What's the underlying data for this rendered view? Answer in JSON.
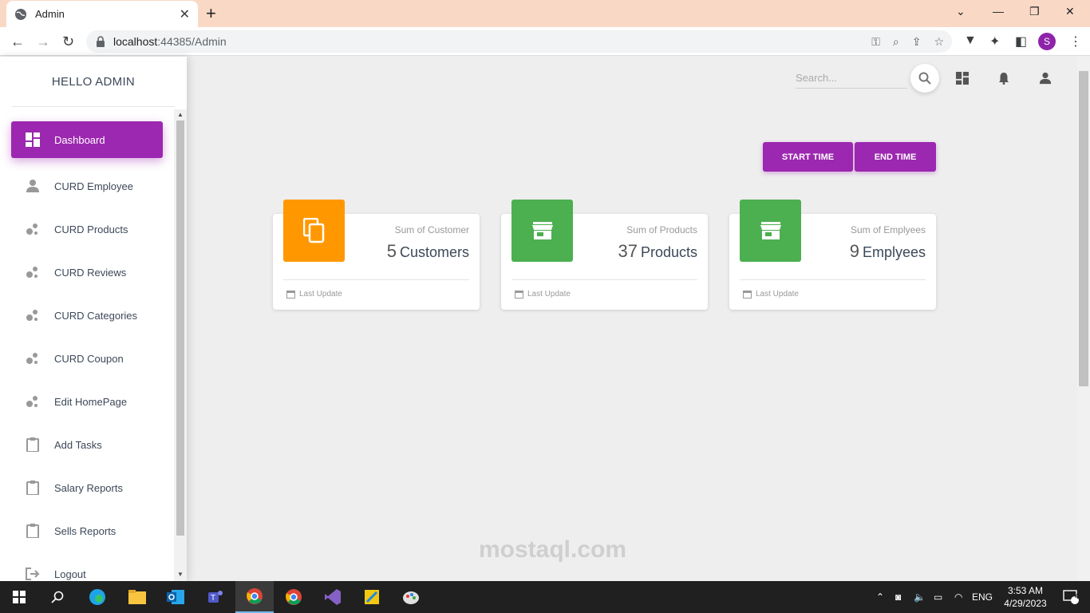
{
  "browser": {
    "tab_title": "Admin",
    "url_host": "localhost",
    "url_port_path": ":44385/Admin",
    "profile_initial": "S"
  },
  "sidebar": {
    "brand": "HELLO ADMIN",
    "items": [
      {
        "label": "Dashboard",
        "icon": "dashboard-icon",
        "active": true
      },
      {
        "label": "CURD Employee",
        "icon": "person-icon"
      },
      {
        "label": "CURD Products",
        "icon": "bubble-chart-icon"
      },
      {
        "label": "CURD Reviews",
        "icon": "bubble-chart-icon"
      },
      {
        "label": "CURD Categories",
        "icon": "bubble-chart-icon"
      },
      {
        "label": "CURD Coupon",
        "icon": "bubble-chart-icon"
      },
      {
        "label": "Edit HomePage",
        "icon": "bubble-chart-icon"
      },
      {
        "label": "Add Tasks",
        "icon": "clipboard-icon"
      },
      {
        "label": "Salary Reports",
        "icon": "clipboard-icon"
      },
      {
        "label": "Sells Reports",
        "icon": "clipboard-icon"
      },
      {
        "label": "Logout",
        "icon": "logout-icon"
      }
    ]
  },
  "header": {
    "search_placeholder": "Search..."
  },
  "actions": {
    "start_time": "START TIME",
    "end_time": "END TIME"
  },
  "cards": [
    {
      "category": "Sum of Customer",
      "value": "5",
      "unit": "Customers",
      "footer": "Last Update",
      "color": "#ff9800",
      "icon": "content-copy-icon"
    },
    {
      "category": "Sum of Products",
      "value": "37",
      "unit": "Products",
      "footer": "Last Update",
      "color": "#4caf50",
      "icon": "store-icon"
    },
    {
      "category": "Sum of Emplyees",
      "value": "9",
      "unit": "Emplyees",
      "footer": "Last Update",
      "color": "#4caf50",
      "icon": "store-icon"
    }
  ],
  "watermark": "mostaql.com",
  "taskbar": {
    "language": "ENG",
    "time": "3:53 AM",
    "date": "4/29/2023",
    "notifications": "4"
  },
  "colors": {
    "primary": "#9c27b0",
    "orange": "#ff9800",
    "green": "#4caf50"
  }
}
